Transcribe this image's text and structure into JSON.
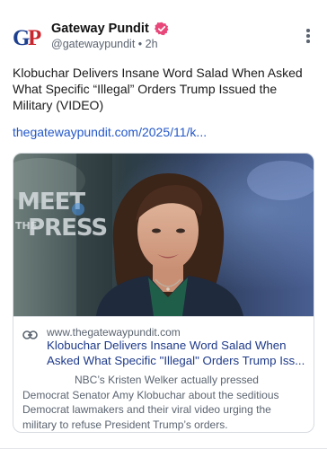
{
  "post": {
    "author_name": "Gateway Pundit",
    "handle": "@gatewaypundit",
    "separator": "•",
    "time": "2h",
    "avatar_text": "GP",
    "text": "Klobuchar Delivers Insane Word Salad When Asked What Specific “Illegal” Orders Trump Issued the Military (VIDEO)",
    "link_text": "thegatewaypundit.com/2025/11/k..."
  },
  "card": {
    "thumbnail_overlay_text": "MEET THE PRESS",
    "domain": "www.thegatewaypundit.com",
    "title_line1": "Klobuchar Delivers Insane Word Salad When",
    "title_line2": "Asked What Specific \"Illegal\" Orders Trump Iss...",
    "description": "NBC’s Kristen Welker actually pressed Democrat Senator Amy Klobuchar about the seditious Democrat lawmakers and their viral video urging the military to refuse President Trump’s orders."
  },
  "icons": {
    "verified": "verified-badge-icon",
    "more": "more-vertical-icon",
    "link": "link-chain-icon"
  },
  "colors": {
    "link": "#2357c8",
    "card_title": "#1e3a8a",
    "verified": "#e8477a",
    "avatar_blue": "#1d3f8f",
    "avatar_red": "#c8262e"
  }
}
